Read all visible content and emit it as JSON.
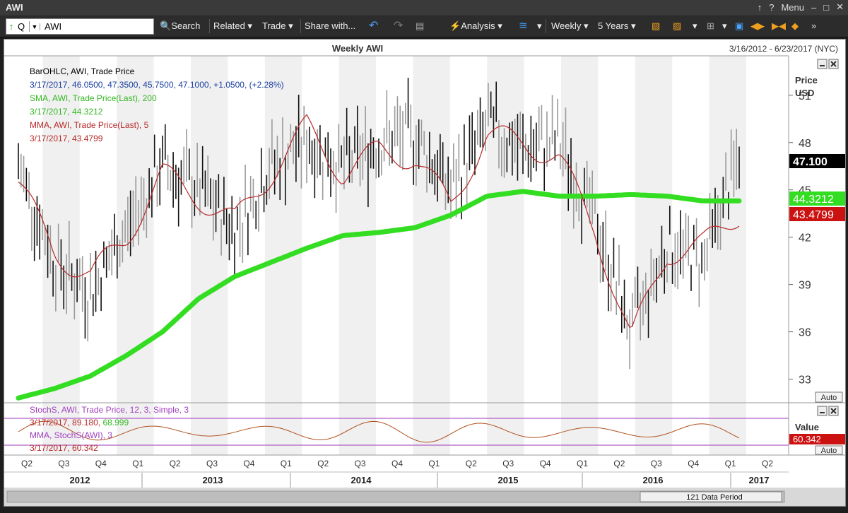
{
  "window": {
    "title": "AWI",
    "menu_label": "Menu",
    "pin_glyph": "↑",
    "help_glyph": "?",
    "minimize_glyph": "–",
    "maximize_glyph": "□",
    "close_glyph": "✕"
  },
  "toolbar": {
    "symbol_prefix": "Q",
    "symbol_value": "AWI",
    "search_label": "Search",
    "related_label": "Related",
    "trade_label": "Trade",
    "share_label": "Share with...",
    "analysis_label": "Analysis",
    "period_label": "Weekly",
    "range_label": "5 Years"
  },
  "chart_header": {
    "title": "Weekly AWI",
    "date_range": "3/16/2012 - 6/23/2017 (NYC)"
  },
  "legend": {
    "bar_title": "BarOHLC, AWI, Trade Price",
    "bar_values": "3/17/2017, 46.0500, 47.3500, 45.7500, 47.1000, +1.0500, (+2.28%)",
    "sma_title": "SMA, AWI, Trade Price(Last), 200",
    "sma_value": "3/17/2017, 44.3212",
    "mma_title": "MMA, AWI, Trade Price(Last), 5",
    "mma_value": "3/17/2017, 43.4799"
  },
  "price_axis": {
    "title": "Price",
    "unit": "USD",
    "ticks": [
      "51",
      "48",
      "45",
      "42",
      "39",
      "36",
      "33"
    ],
    "last_price": "47.100",
    "sma_tag": "44.3212",
    "mma_tag": "43.4799",
    "auto_label": "Auto"
  },
  "stoch_panel": {
    "title": "StochS, AWI, Trade Price, 12, 3, Simple, 3",
    "values_prefix": "3/17/2017, 89.180,",
    "values_green": "68.999",
    "mma_title": "MMA, StochS(AWI), 3",
    "mma_value": "3/17/2017, 60.342",
    "axis_title": "Value",
    "value_tag": "60.342",
    "auto_label": "Auto"
  },
  "time_axis": {
    "quarters": [
      "Q2",
      "Q3",
      "Q4",
      "Q1",
      "Q2",
      "Q3",
      "Q4",
      "Q1",
      "Q2",
      "Q3",
      "Q4",
      "Q1",
      "Q2",
      "Q3",
      "Q4",
      "Q1",
      "Q2",
      "Q3",
      "Q4",
      "Q1",
      "Q2"
    ],
    "years": [
      "2012",
      "2013",
      "2014",
      "2015",
      "2016",
      "2017"
    ]
  },
  "footer": {
    "data_period": "121 Data Period"
  },
  "colors": {
    "sma": "#33dd22",
    "mma": "#b82a2a",
    "bars_dark": "#111111",
    "bars_gray": "#9a9a9a",
    "stoch_line": "#b0501e",
    "stoch_band": "#b060c8",
    "last_tag_bg": "#000000",
    "sma_tag_bg": "#33dd22",
    "mma_tag_bg": "#cc1111"
  },
  "chart_data": {
    "type": "line",
    "title": "Weekly AWI",
    "ylabel": "Price",
    "ylim": [
      31.5,
      53.5
    ],
    "yticks": [
      33,
      36,
      39,
      42,
      45,
      48,
      51
    ],
    "x": [
      "2012-03",
      "2012-06",
      "2012-09",
      "2012-12",
      "2013-03",
      "2013-06",
      "2013-09",
      "2013-12",
      "2014-03",
      "2014-06",
      "2014-09",
      "2014-12",
      "2015-03",
      "2015-06",
      "2015-09",
      "2015-12",
      "2016-03",
      "2016-06",
      "2016-09",
      "2016-12",
      "2017-03"
    ],
    "series": [
      {
        "name": "BarOHLC, AWI, Trade Price",
        "values": [
          46.5,
          40.5,
          38.5,
          42.5,
          46.5,
          45.0,
          42.5,
          46.5,
          48.0,
          46.5,
          48.0,
          48.5,
          45.0,
          49.0,
          47.5,
          48.0,
          43.0,
          36.0,
          41.5,
          40.5,
          47.1
        ]
      },
      {
        "name": "SMA, AWI, Trade Price(Last), 200",
        "values": [
          31.8,
          32.4,
          33.2,
          34.5,
          36.0,
          38.1,
          39.5,
          40.4,
          41.3,
          42.1,
          42.3,
          42.6,
          43.4,
          44.6,
          44.9,
          44.6,
          44.6,
          44.7,
          44.6,
          44.3,
          44.3
        ]
      },
      {
        "name": "MMA, AWI, Trade Price(Last), 5",
        "values": [
          45.5,
          41.0,
          39.5,
          42.0,
          46.0,
          44.5,
          43.0,
          46.0,
          49.0,
          46.0,
          47.5,
          47.0,
          44.0,
          48.5,
          48.0,
          47.0,
          42.5,
          35.5,
          41.0,
          41.5,
          43.5
        ]
      }
    ],
    "last_bar": {
      "date": "3/17/2017",
      "open": 46.05,
      "high": 47.35,
      "low": 45.75,
      "close": 47.1,
      "change": 1.05,
      "change_pct": 2.28
    },
    "stoch": {
      "k": 89.18,
      "d": 68.999,
      "mma": 60.342
    }
  }
}
